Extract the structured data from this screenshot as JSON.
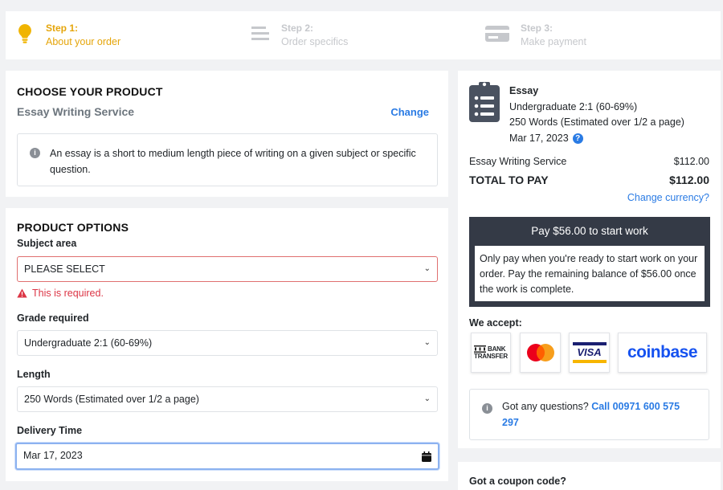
{
  "steps": [
    {
      "title": "Step 1:",
      "subtitle": "About your order",
      "icon": "lightbulb-icon",
      "state": "active"
    },
    {
      "title": "Step 2:",
      "subtitle": "Order specifics",
      "icon": "list-lines-icon",
      "state": "inactive"
    },
    {
      "title": "Step 3:",
      "subtitle": "Make payment",
      "icon": "credit-card-icon",
      "state": "inactive"
    }
  ],
  "product": {
    "heading": "CHOOSE YOUR PRODUCT",
    "name": "Essay Writing Service",
    "change_label": "Change",
    "description": "An essay is a short to medium length piece of writing on a given subject or specific question."
  },
  "options": {
    "heading": "PRODUCT OPTIONS",
    "subject_label": "Subject area",
    "subject_value": "PLEASE SELECT",
    "subject_error": "This is required.",
    "grade_label": "Grade required",
    "grade_value": "Undergraduate 2:1 (60-69%)",
    "length_label": "Length",
    "length_value": "250 Words (Estimated over 1/2 a page)",
    "delivery_label": "Delivery Time",
    "delivery_value": "Mar 17, 2023"
  },
  "summary": {
    "title": "Essay",
    "grade": "Undergraduate 2:1 (60-69%)",
    "length": "250 Words (Estimated over 1/2 a page)",
    "date": "Mar 17, 2023",
    "service_label": "Essay Writing Service",
    "service_price": "$112.00",
    "total_label": "TOTAL TO PAY",
    "total_price": "$112.00",
    "change_currency": "Change currency?",
    "pay_button": "Pay $56.00 to start work",
    "pay_note": "Only pay when you're ready to start work on your order. Pay the remaining balance of $56.00 once the work is complete.",
    "accept_label": "We accept:",
    "payment_methods": [
      "BANK TRANSFER",
      "Mastercard",
      "VISA",
      "coinbase"
    ],
    "questions_text": "Got any questions?",
    "questions_link": "Call 00971 600 575 297",
    "coupon_label": "Got a coupon code?"
  },
  "colors": {
    "accent": "#e5a50a",
    "link": "#2a7be4",
    "error": "#dc3545",
    "dark": "#343a46"
  }
}
